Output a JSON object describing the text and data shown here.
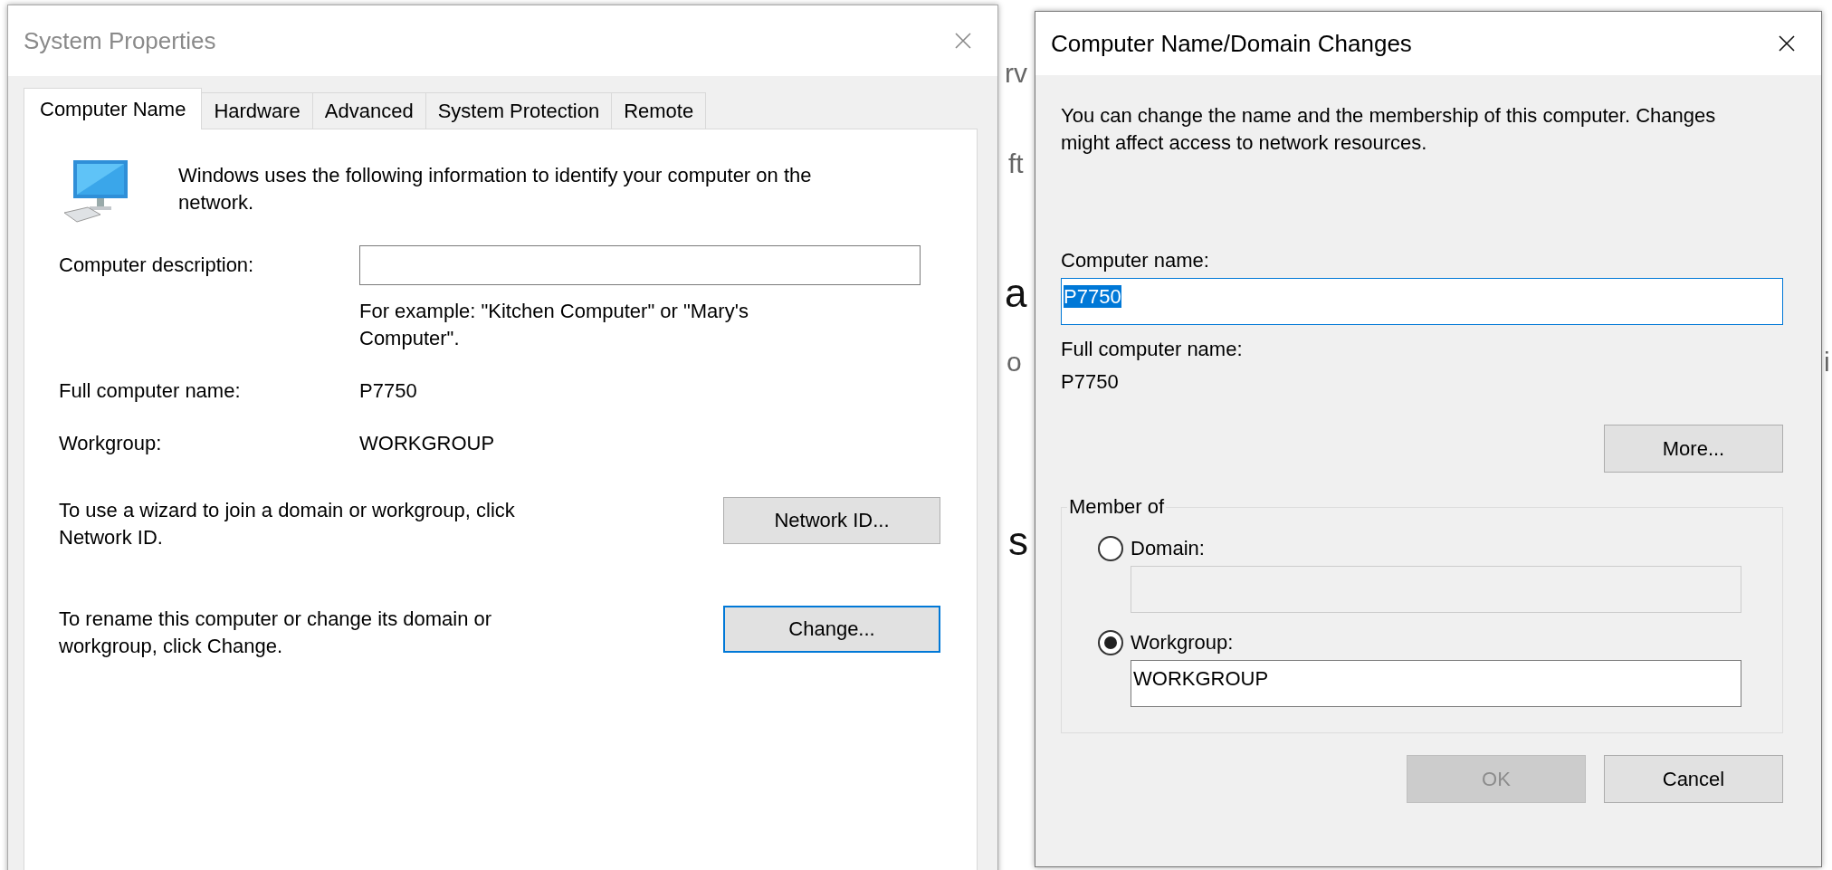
{
  "background_text": [
    {
      "text": "rv"
    },
    {
      "text": "ft"
    },
    {
      "text": "a"
    },
    {
      "text": "o"
    },
    {
      "text": "s"
    },
    {
      "text": "i"
    }
  ],
  "system_properties": {
    "title": "System Properties",
    "tabs": [
      {
        "label": "Computer Name",
        "selected": true
      },
      {
        "label": "Hardware",
        "selected": false
      },
      {
        "label": "Advanced",
        "selected": false
      },
      {
        "label": "System Protection",
        "selected": false
      },
      {
        "label": "Remote",
        "selected": false
      }
    ],
    "intro": "Windows uses the following information to identify your computer on the network.",
    "description": {
      "label": "Computer description:"
    },
    "example": "For example: \"Kitchen Computer\" or \"Mary's Computer\".",
    "info_rows": [
      {
        "label": "Full computer name:",
        "value": "P7750"
      },
      {
        "label": "Workgroup:",
        "value": "WORKGROUP"
      }
    ],
    "actions": [
      {
        "text": "To use a wizard to join a domain or workgroup, click Network ID.",
        "button": "Network ID...",
        "focused": false
      },
      {
        "text": "To rename this computer or change its domain or workgroup, click Change.",
        "button": "Change...",
        "focused": true
      }
    ]
  },
  "domain_changes": {
    "title": "Computer Name/Domain Changes",
    "intro": "You can change the name and the membership of this computer. Changes might affect access to network resources.",
    "computer_name": {
      "label": "Computer name:",
      "value": "P7750",
      "focused": true,
      "text_selected": true
    },
    "full_name": {
      "label": "Full computer name:",
      "value": "P7750"
    },
    "more_button": "More...",
    "member_of": {
      "title": "Member of",
      "options": [
        {
          "label": "Domain:",
          "selected": false,
          "field_disabled": true
        },
        {
          "label": "Workgroup:",
          "selected": true,
          "value": "WORKGROUP",
          "field_disabled": false
        }
      ]
    },
    "buttons": [
      {
        "label": "OK",
        "disabled": true
      },
      {
        "label": "Cancel",
        "disabled": false
      }
    ]
  }
}
